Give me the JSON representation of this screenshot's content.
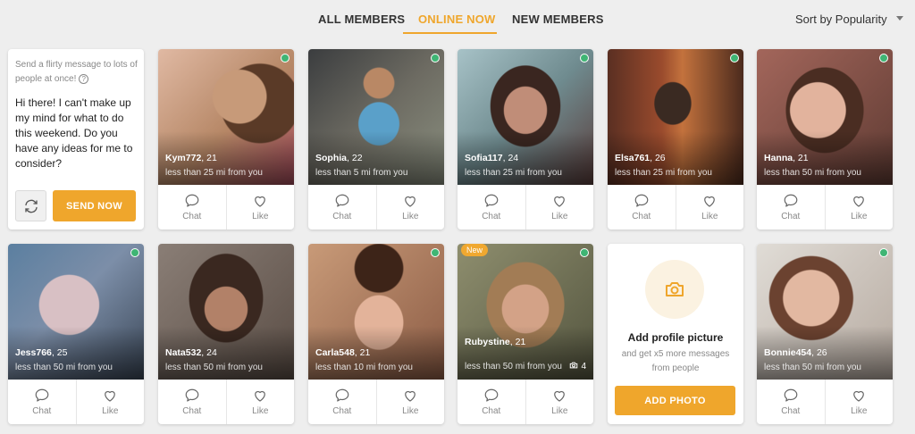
{
  "tabs": [
    {
      "label": "ALL MEMBERS",
      "active": false
    },
    {
      "label": "ONLINE NOW",
      "active": true
    },
    {
      "label": "NEW MEMBERS",
      "active": false
    }
  ],
  "sort": {
    "label": "Sort by Popularity"
  },
  "colors": {
    "accent": "#efa62c",
    "online": "#3fb574",
    "background": "#eeeeee"
  },
  "message_panel": {
    "hint": "Send a flirty message to lots of people at once!",
    "message": "Hi there! I can't make up my mind for what to do this weekend. Do you have any ideas for me to consider?",
    "refresh_icon": "refresh-icon",
    "send_label": "SEND NOW"
  },
  "actions": {
    "chat": "Chat",
    "like": "Like"
  },
  "members": [
    {
      "name": "Kym772",
      "age": ", 21",
      "distance": "less than 25 mi from you",
      "online": true
    },
    {
      "name": "Sophia",
      "age": ", 22",
      "distance": "less than 5 mi from you",
      "online": true
    },
    {
      "name": "Sofia117",
      "age": ", 24",
      "distance": "less than 25 mi from you",
      "online": true
    },
    {
      "name": "Elsa761",
      "age": ", 26",
      "distance": "less than 25 mi from you",
      "online": true
    },
    {
      "name": "Hanna",
      "age": ", 21",
      "distance": "less than 50 mi from you",
      "online": true
    },
    {
      "name": "Jess766",
      "age": ", 25",
      "distance": "less than 50 mi from you",
      "online": true
    },
    {
      "name": "Nata532",
      "age": ", 24",
      "distance": "less than 50 mi from you",
      "online": false
    },
    {
      "name": "Carla548",
      "age": ", 21",
      "distance": "less than 10 mi from you",
      "online": true
    },
    {
      "name": "Rubystine",
      "age": ", 21",
      "distance": "less than 50 mi from you",
      "online": true,
      "badge": "New",
      "photo_count": "4"
    },
    {
      "name": "Bonnie454",
      "age": ", 26",
      "distance": "less than 50 mi from you",
      "online": true
    }
  ],
  "add_photo": {
    "title": "Add profile picture",
    "subtitle": "and get x5 more messages from people",
    "button": "ADD PHOTO"
  }
}
